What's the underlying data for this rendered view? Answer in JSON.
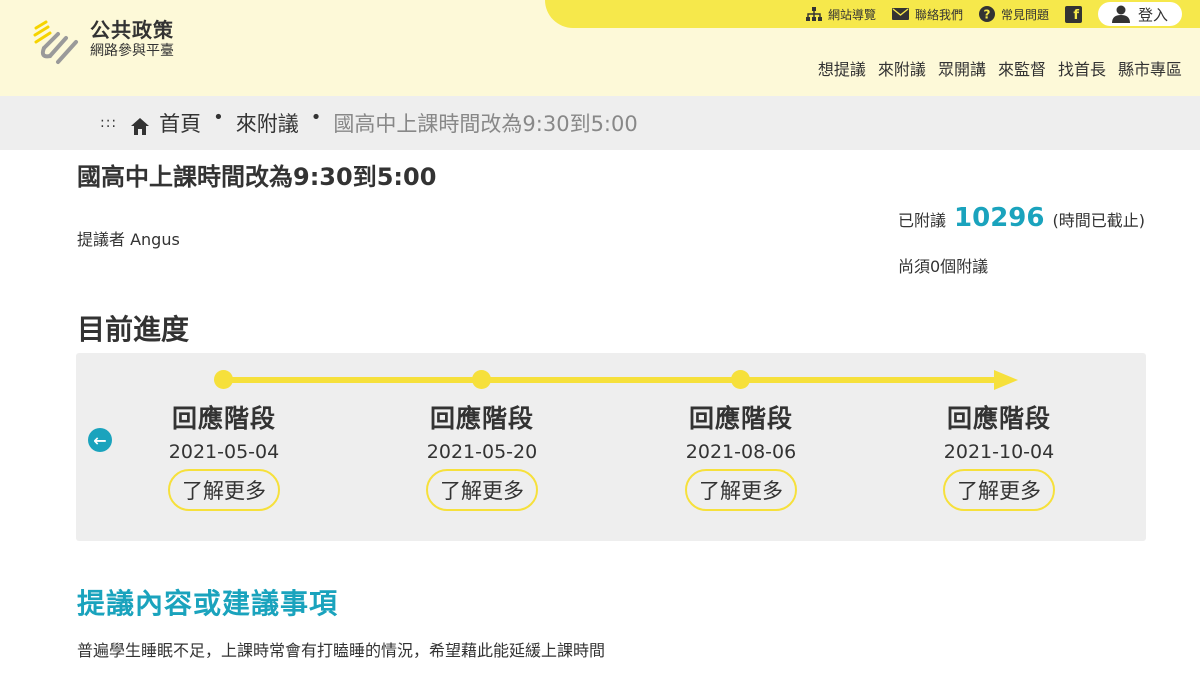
{
  "header": {
    "logo_title": "公共政策",
    "logo_subtitle": "網路參與平臺",
    "top_links": [
      {
        "icon": "sitemap-icon",
        "label": "網站導覽"
      },
      {
        "icon": "mail-icon",
        "label": "聯絡我們"
      },
      {
        "icon": "question-circle-icon",
        "label": "常見問題"
      }
    ],
    "facebook_icon": "facebook-icon",
    "login_label": "登入",
    "nav": [
      "想提議",
      "來附議",
      "眾開講",
      "來監督",
      "找首長",
      "縣市專區"
    ],
    "colors": {
      "topbar": "#f6e84b",
      "header_bg": "#fdf9d8",
      "accent": "#1aa3bd"
    }
  },
  "breadcrumb": {
    "dots": ":::",
    "home": "首頁",
    "section": "來附議",
    "current": "國高中上課時間改為9:30到5:00"
  },
  "proposal": {
    "title": "國高中上課時間改為9:30到5:00",
    "proposer": "提議者 Angus",
    "signed_label": "已附議",
    "signed_count": "10296",
    "signed_status": "(時間已截止)",
    "needed": "尚須0個附議"
  },
  "progress": {
    "heading": "目前進度",
    "stages": [
      {
        "name": "回應階段",
        "date": "2021-05-04",
        "more": "了解更多"
      },
      {
        "name": "回應階段",
        "date": "2021-05-20",
        "more": "了解更多"
      },
      {
        "name": "回應階段",
        "date": "2021-08-06",
        "more": "了解更多"
      },
      {
        "name": "回應階段",
        "date": "2021-10-04",
        "more": "了解更多"
      }
    ]
  },
  "content": {
    "heading": "提議內容或建議事項",
    "text": "普遍學生睡眠不足，上課時常會有打瞌睡的情況，希望藉此能延緩上課時間"
  }
}
